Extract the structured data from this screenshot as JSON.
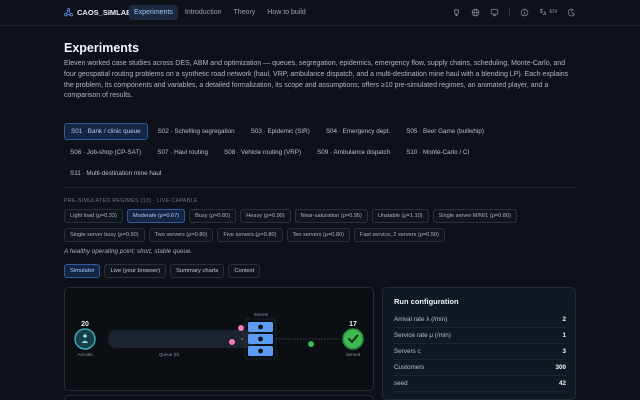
{
  "brand": {
    "name": "CAOS_SIMLAB",
    "logo_icon": "hexagon-nodes-icon"
  },
  "nav": {
    "items": [
      "Experiments",
      "Introduction",
      "Theory",
      "How to build"
    ],
    "active": 0
  },
  "toolbar": {
    "icons": [
      "github-icon",
      "globe-icon",
      "info-icon",
      "translate-icon",
      "moon-icon"
    ],
    "language": "EN"
  },
  "page": {
    "title": "Experiments",
    "intro": "Eleven worked case studies across DES, ABM and optimization — queues, segregation, epidemics, emergency flow, supply chains, scheduling, Monte-Carlo, and four geospatial routing problems on a synthetic road network (haul, VRP, ambulance dispatch, and a multi-destination mine haul with a blending LP). Each explains the problem, its components and variables, a detailed formalization, its scope and assumptions; offers ≥10 pre-simulated regimes, an animated player, and a comparison of results."
  },
  "cases": {
    "rows": [
      [
        "S01 · Bank / clinic queue",
        "S02 · Schelling segregation",
        "S03 · Epidemic (SIR)",
        "S04 · Emergency dept.",
        "S05 · Beer Game (bullwhip)"
      ],
      [
        "S06 · Job-shop (CP-SAT)",
        "S07 · Haul routing",
        "S08 · Vehicle routing (VRP)",
        "S09 · Ambulance dispatch",
        "S10 · Monte-Carlo / CI"
      ],
      [
        "S11 · Multi-destination mine haul"
      ]
    ],
    "active": "S01 · Bank / clinic queue"
  },
  "regimes": {
    "label": "PRE-SIMULATED REGIMES (13) · LIVE-CAPABLE",
    "rows": [
      [
        "Light load (ρ=0.33)",
        "Moderate (ρ=0.67)",
        "Busy (ρ=0.80)",
        "Heavy (ρ=0.90)",
        "Near-saturation (ρ=0.95)",
        "Unstable (ρ=1.10)",
        "Single server M/M/1 (ρ=0.80)"
      ],
      [
        "Single server busy (ρ=0.90)",
        "Two servers (ρ=0.80)",
        "Five servers (ρ=0.80)",
        "Ten servers (ρ=0.80)",
        "Fast service, 2 servers (ρ=0.50)"
      ]
    ],
    "active": "Moderate (ρ=0.67)",
    "description": "A healthy operating point; short, stable queue."
  },
  "view_tabs": {
    "items": [
      "Simulator",
      "Live (your browser)",
      "Summary charts",
      "Context"
    ],
    "active": 0
  },
  "simulator": {
    "arrivals_count": "20",
    "arrivals_label": "Arrivals",
    "arrivals_icon": "person-icon",
    "queue_label": "Queue (0)",
    "servers_label": "Servers",
    "served_count": "17",
    "served_label": "Served",
    "served_icon": "check-icon",
    "colors": {
      "arrivals": "#3fa7b8",
      "server": "#5b9cf5",
      "served": "#3fb950",
      "customer": "#f778ba"
    }
  },
  "run_config": {
    "title": "Run configuration",
    "rows": [
      {
        "label": "Arrival rate λ (/min)",
        "value": "2"
      },
      {
        "label": "Service rate μ (/min)",
        "value": "1"
      },
      {
        "label": "Servers c",
        "value": "3"
      },
      {
        "label": "Customers",
        "value": "300"
      },
      {
        "label": "seed",
        "value": "42"
      }
    ]
  }
}
